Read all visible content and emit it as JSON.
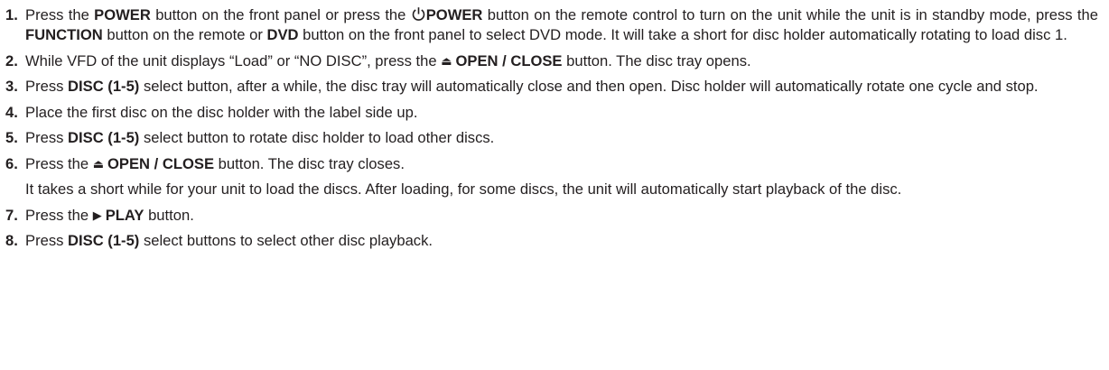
{
  "steps": [
    {
      "num": "1.",
      "a": "Press the ",
      "b1": "POWER",
      "c": " button on the front panel or press the ",
      "b2": "POWER",
      "d": " button on the remote control to turn on the unit while the unit is in standby mode, press the ",
      "b3": "FUNCTION",
      "e": " button on the remote or ",
      "b4": "DVD",
      "f": " button on the front panel to select DVD mode. It will take a short for disc holder automatically rotating to load disc 1."
    },
    {
      "num": "2.",
      "a": "While VFD of the unit displays “Load” or “NO DISC”, press the ",
      "b1": "OPEN / CLOSE",
      "c": " button. The disc tray opens."
    },
    {
      "num": "3.",
      "a": "Press ",
      "b1": "DISC (1-5)",
      "c": " select button, after a while, the disc tray will automatically close and then open. Disc holder will automatically rotate one cycle and stop."
    },
    {
      "num": "4.",
      "a": "Place the first disc on the disc holder with the label side up."
    },
    {
      "num": "5.",
      "a": "Press ",
      "b1": "DISC (1-5)",
      "c": " select button to rotate disc holder to load other discs."
    },
    {
      "num": "6.",
      "a": "Press the ",
      "b1": "OPEN / CLOSE",
      "c": " button. The disc tray closes.",
      "note": "It takes a short while for your unit to load the discs. After loading, for some discs, the unit will automatically start playback of the disc."
    },
    {
      "num": "7.",
      "a": "Press the ",
      "b1": "PLAY",
      "c": " button."
    },
    {
      "num": "8.",
      "a": "Press ",
      "b1": "DISC (1-5)",
      "c": " select buttons to select other disc playback."
    }
  ]
}
